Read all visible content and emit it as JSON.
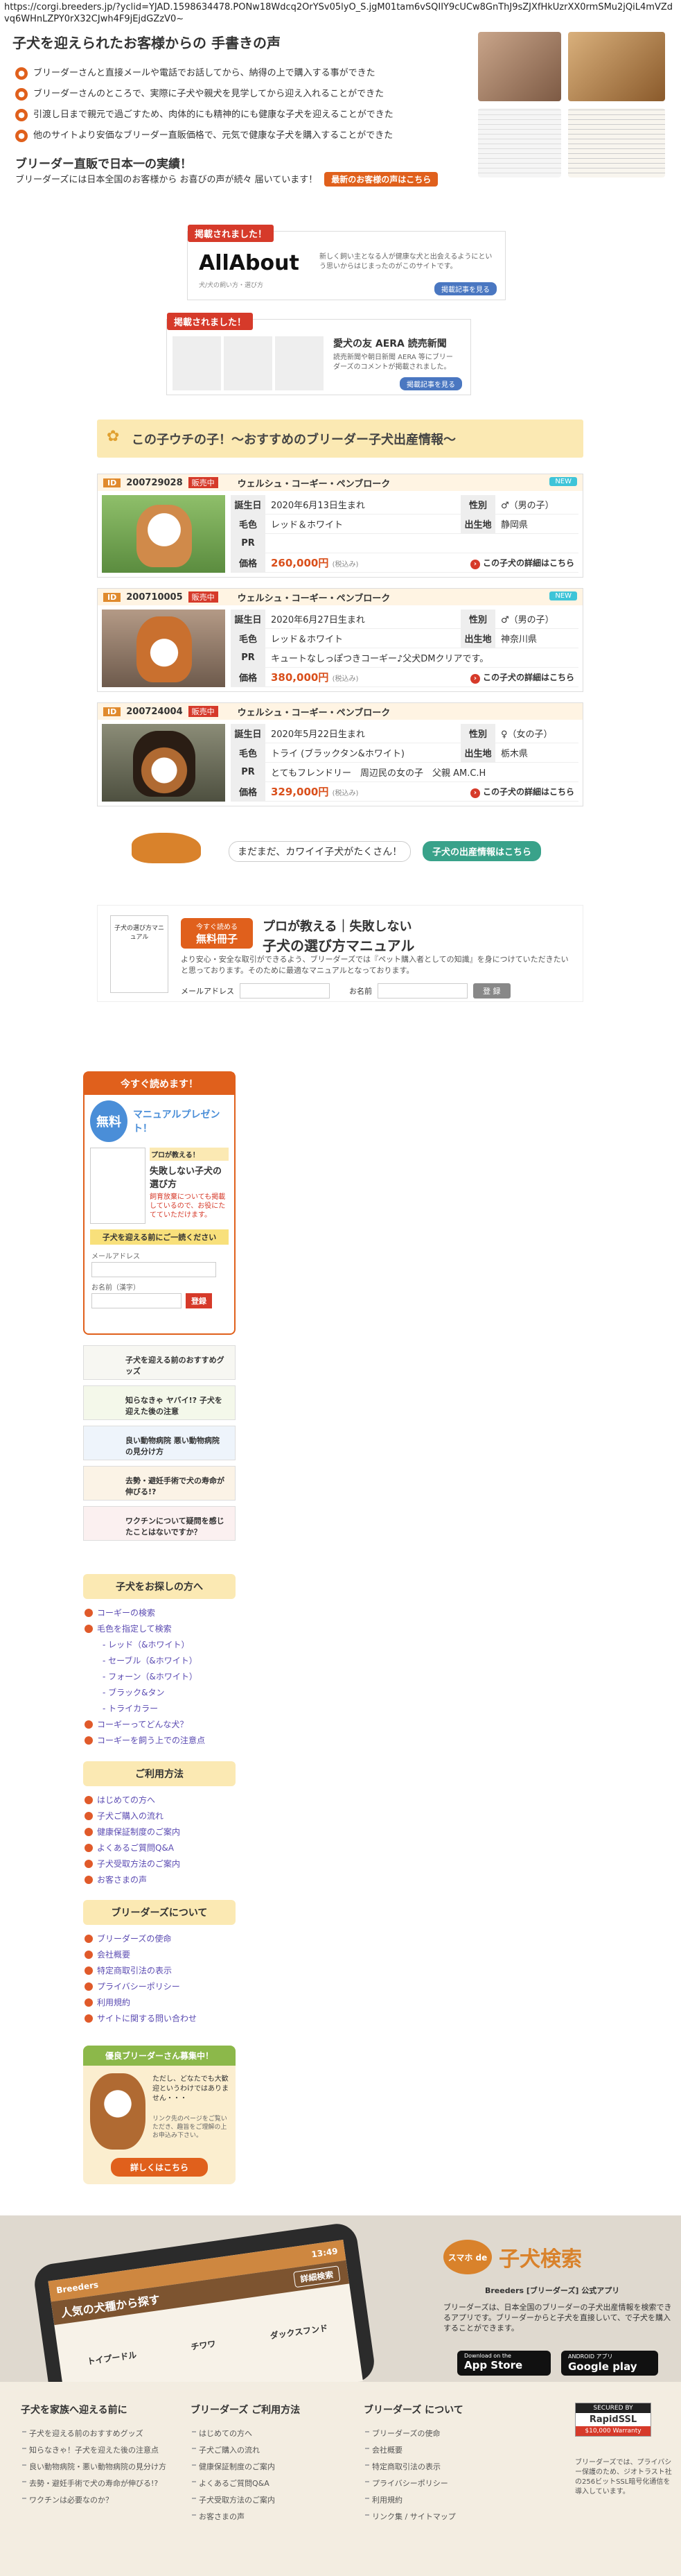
{
  "url": "https://corgi.breeders.jp/?yclid=YJAD.1598634478.PONw18Wdcq2OrYSv05lyO_S.jgM01tam6vSQIIY9cUCw8GnThJ9sZJXfHkUzrXX0rmSMu2jQiL4mVZdvq6WHnLZPY0rX32CJwh4F9jEjdGZzV0~",
  "hero": {
    "title": "子犬を迎えられたお客様からの 手書きの声",
    "benefits": [
      "ブリーダーさんと直接メールや電話でお話してから、納得の上で購入する事ができた",
      "ブリーダーさんのところで、実際に子犬や親犬を見学してから迎え入れることができた",
      "引渡し日まで親元で過ごすため、肉体的にも精神的にも健康な子犬を迎えることができた",
      "他のサイトより安価なブリーダー直販価格で、元気で健康な子犬を購入することができた"
    ],
    "subtitle": "ブリーダー直販で日本一の実績！",
    "sub_text": "ブリーダーズには日本全国のお客様から お喜びの声が続々 届いています！",
    "sub_button": "最新のお客様の声はこちら"
  },
  "media1": {
    "ribbon": "掲載されました！",
    "logo": "AllAbout",
    "logo_sub": "犬/犬の飼い方・選び方",
    "text": "新しく飼い主となる人が健康な犬と出会えるようにという思いからはじまったのがこのサイトです。",
    "button": "掲載記事を見る"
  },
  "media2": {
    "ribbon": "掲載されました！",
    "logo": "愛犬の友 AERA 読売新聞",
    "text": "読売新聞や朝日新聞 AERA 等にブリーダーズのコメントが掲載されました。",
    "button": "掲載記事を見る"
  },
  "section_title": "この子ウチの子！～おすすめのブリーダー子犬出産情報～",
  "puppies": [
    {
      "id": "200729028",
      "status": "販売中",
      "breed": "ウェルシュ・コーギー・ペンブローク",
      "birth": "2020年6月13日生まれ",
      "sex": "♂（男の子）",
      "color": "レッド＆ホワイト",
      "origin": "静岡県",
      "pr": "",
      "price": "260,000円",
      "tax": "(税込み)",
      "new": "NEW",
      "more": "この子犬の詳細はこちら"
    },
    {
      "id": "200710005",
      "status": "販売中",
      "breed": "ウェルシュ・コーギー・ペンブローク",
      "birth": "2020年6月27日生まれ",
      "sex": "♂（男の子）",
      "color": "レッド＆ホワイト",
      "origin": "神奈川県",
      "pr": "キュートなしっぽつきコーギー♪父犬DMクリアです。",
      "price": "380,000円",
      "tax": "(税込み)",
      "new": "NEW",
      "more": "この子犬の詳細はこちら"
    },
    {
      "id": "200724004",
      "status": "販売中",
      "breed": "ウェルシュ・コーギー・ペンブローク",
      "birth": "2020年5月22日生まれ",
      "sex": "♀（女の子）",
      "color": "トライ (ブラックタン&ホワイト)",
      "origin": "栃木県",
      "pr": "とてもフレンドリー　周辺民の女の子　父親 AM.C.H",
      "price": "329,000円",
      "tax": "(税込み)",
      "new": "",
      "more": "この子犬の詳細はこちら"
    }
  ],
  "labels": {
    "birth": "誕生日",
    "color": "毛色",
    "pr": "PR",
    "price": "価格",
    "sex": "性別",
    "origin": "出生地",
    "id": "ID"
  },
  "more_puppies": "まだまだ、カワイイ子犬がたくさん！",
  "more_button": "子犬の出産情報はこちら",
  "manual": {
    "badge1": "今すぐ読める",
    "badge2": "無料冊子",
    "title1": "プロが教える｜失敗しない",
    "title2": "子犬の選び方マニュアル",
    "text": "より安心・安全な取引ができるよう、ブリーダーズでは『ペット購入者としての知識』を身につけていただきたいと思っております。そのために最適なマニュアルとなっております。",
    "email_label": "メールアドレス",
    "name_label": "お名前",
    "submit": "登 録",
    "book_title": "子犬の選び方マニュアル"
  },
  "side": {
    "read_now": "今すぐ読めます！",
    "free": "無料",
    "present": "マニュアルプレゼント！",
    "pro": "プロが教える！",
    "manual_title": "失敗しない子犬の選び方",
    "manual_desc": "飼育放棄についても掲載しているので、お役にたてていただけます。",
    "cta": "子犬を迎える前にご一読ください",
    "email_label": "メールアドレス",
    "name_label": "お名前（漢字）",
    "submit": "登録",
    "banners": [
      "子犬を迎える前のおすすめグッズ",
      "知らなきゃ ヤバイ!? 子犬を迎えた後の注意",
      "良い動物病院 悪い動物病院 の見分け方",
      "去勢・避妊手術で犬の寿命が伸びる!?",
      "ワクチンについて疑問を感じたことはないですか？"
    ],
    "search_title": "子犬をお探しの方へ",
    "search_items": [
      {
        "text": "コーギーの検索",
        "sub": false
      },
      {
        "text": "毛色を指定して検索",
        "sub": false
      },
      {
        "text": "- レッド（&ホワイト）",
        "sub": true
      },
      {
        "text": "- セーブル（&ホワイト）",
        "sub": true
      },
      {
        "text": "- フォーン（&ホワイト）",
        "sub": true
      },
      {
        "text": "- ブラック&タン",
        "sub": true
      },
      {
        "text": "- トライカラー",
        "sub": true
      },
      {
        "text": "コーギーってどんな犬？",
        "sub": false
      },
      {
        "text": "コーギーを飼う上での注意点",
        "sub": false
      }
    ],
    "usage_title": "ご利用方法",
    "usage_items": [
      "はじめての方へ",
      "子犬ご購入の流れ",
      "健康保証制度のご案内",
      "よくあるご質問Q&A",
      "子犬受取方法のご案内",
      "お客さまの声"
    ],
    "about_title": "ブリーダーズについて",
    "about_items": [
      "ブリーダーズの使命",
      "会社概要",
      "特定商取引法の表示",
      "プライバシーポリシー",
      "利用規約",
      "サイトに関する問い合わせ"
    ],
    "recruit_title": "優良ブリーダーさん募集中！",
    "recruit_text": "ただし、どなたでも大歓迎というわけではありません・・・",
    "recruit_sub": "リンク先のページをご覧いただき、趣旨をご理解の上お申込み下さい。",
    "recruit_button": "詳しくはこちら"
  },
  "app": {
    "title": "子犬検索",
    "smaho": "スマホ de",
    "app_name": "Breeders [ブリーダーズ] 公式アプリ",
    "desc": "ブリーダーズは、日本全国のブリーダーの子犬出産情報を検索できるアプリです。ブリーダーからと子犬を直接しいて、で子犬を購入することができます。",
    "appstore": "App Store",
    "appstore_pre": "Download on the",
    "gplay": "Google play",
    "gplay_pre": "ANDROID アプリ",
    "phone_title": "人気の犬種から探す",
    "phone_logo": "Breeders",
    "phone_time": "13:49",
    "phone_button": "詳細検索",
    "dogs": [
      "トイプードル",
      "チワワ",
      "ダックスフンド"
    ]
  },
  "footer": {
    "col1_title": "子犬を家族へ迎える前に",
    "col1": [
      "子犬を迎える前のおすすめグッズ",
      "知らなきゃ！子犬を迎えた後の注意点",
      "良い動物病院・悪い動物病院の見分け方",
      "去勢・避妊手術で犬の寿命が伸びる!?",
      "ワクチンは必要なのか？"
    ],
    "col2_title": "ブリーダーズ ご利用方法",
    "col2": [
      "はじめての方へ",
      "子犬ご購入の流れ",
      "健康保証制度のご案内",
      "よくあるご質問Q&A",
      "子犬受取方法のご案内",
      "お客さまの声"
    ],
    "col3_title": "ブリーダーズ について",
    "col3": [
      "ブリーダーズの使命",
      "会社概要",
      "特定商取引法の表示",
      "プライバシーポリシー",
      "利用規約",
      "リンク集 / サイトマップ"
    ],
    "ssl_label": "SECURED BY",
    "ssl_brand": "RapidSSL",
    "ssl_warranty": "$10,000 Warranty",
    "ssl_text": "ブリーダーズでは、プライバシー保護のため、ジオトラスト社の256ビットSSL暗号化通信を導入しています。"
  }
}
